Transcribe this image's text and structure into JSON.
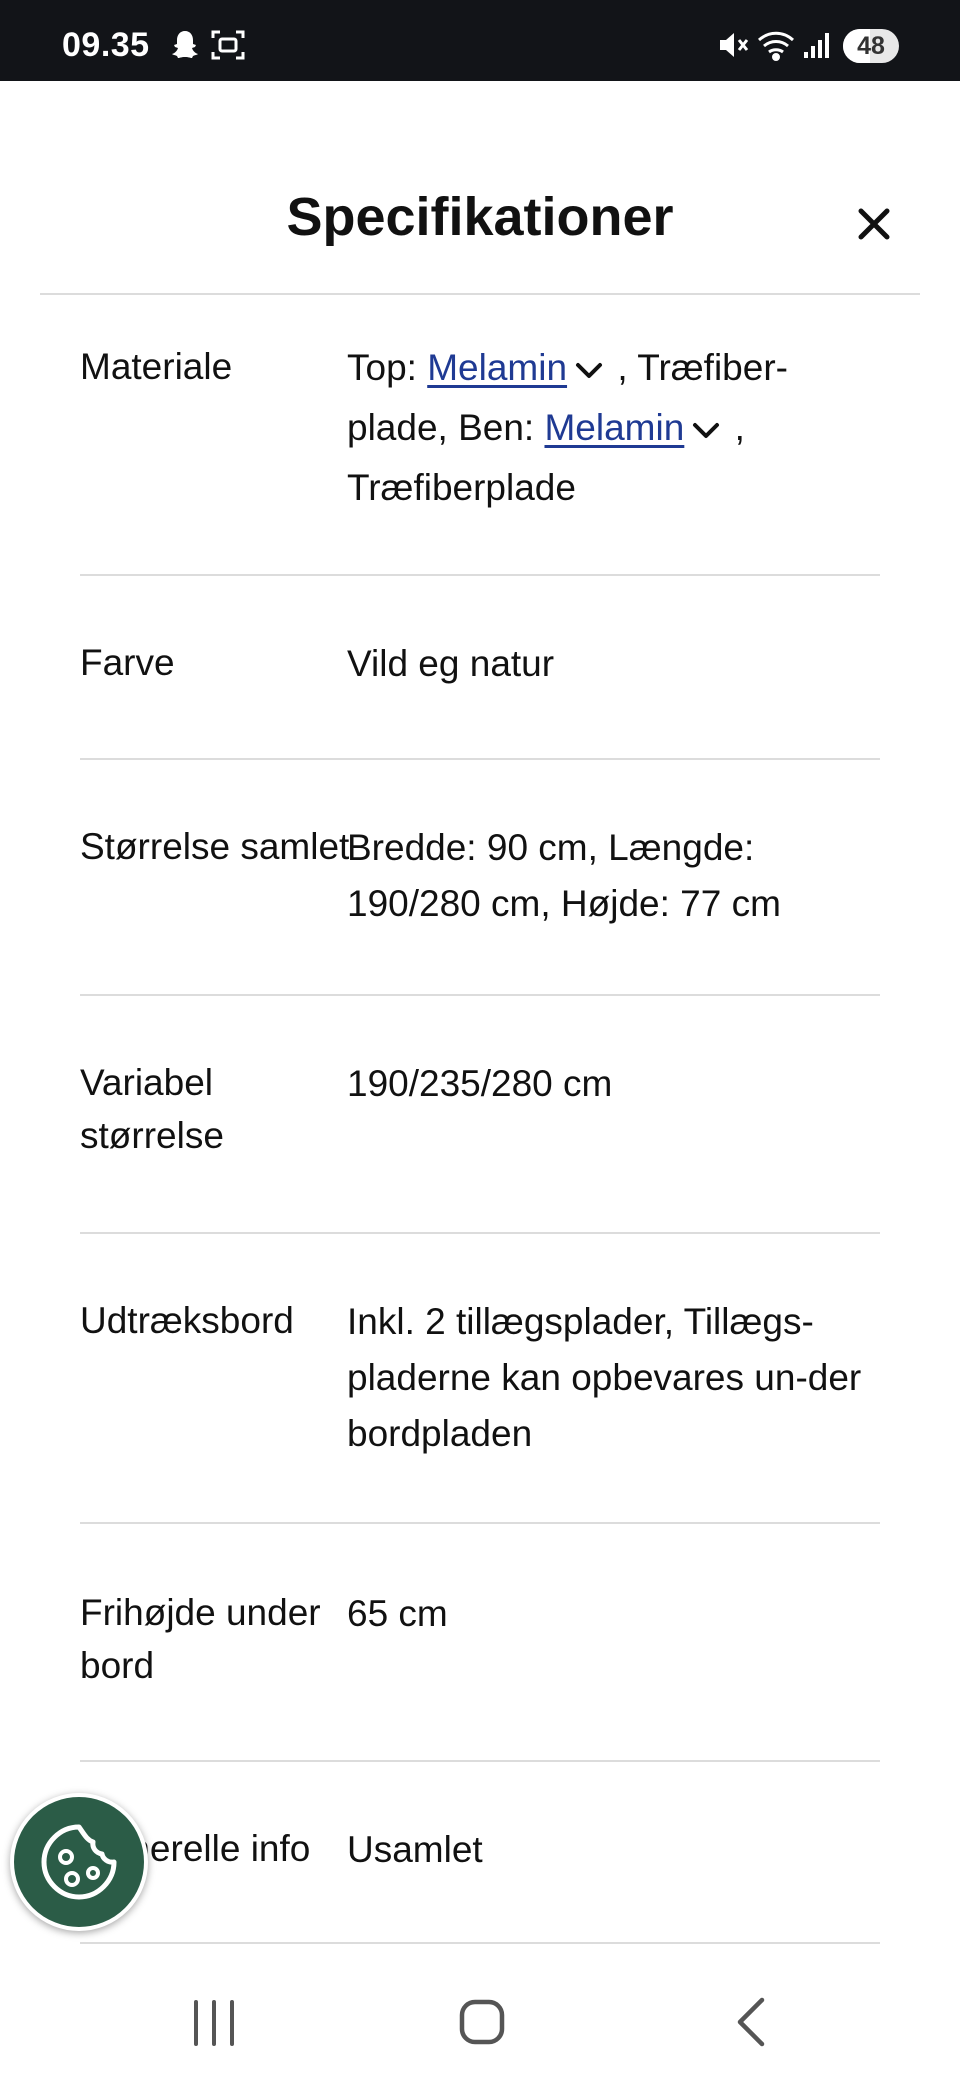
{
  "status_bar": {
    "time": "09.35",
    "battery": "48",
    "battery_level": 0.48,
    "icons": [
      "snapchat-icon",
      "screenshot-icon",
      "mute-icon",
      "wifi-icon",
      "signal-icon"
    ]
  },
  "sheet": {
    "title": "Specifikationer",
    "close_icon": "close-icon"
  },
  "specs": {
    "materiale": {
      "label": "Materiale",
      "top_prefix": "Top: ",
      "top_link": "Melamin",
      "top_suffix": " , Træfiber-plade, Ben: ",
      "ben_link": "Melamin",
      "ben_suffix": " , Træfiberplade"
    },
    "farve": {
      "label": "Farve",
      "value": "Vild eg natur"
    },
    "stoerrelse": {
      "label": "Størrelse samlet",
      "value": "Bredde: 90 cm, Længde: 190/280 cm, Højde: 77 cm"
    },
    "variabel": {
      "label": "Variabel størrelse",
      "value": "190/235/280 cm"
    },
    "udtraek": {
      "label": "Udtræksbord",
      "value": "Inkl. 2 tillægsplader, Tillægs-pladerne kan opbevares un-der bordpladen"
    },
    "frihoejde": {
      "label": "Frihøjde under bord",
      "value": "65 cm"
    },
    "generel": {
      "label": "Generelle info",
      "label_visible": "nle info",
      "value": "Usamlet"
    }
  },
  "cookie": {
    "icon": "cookie-icon"
  },
  "navbar": {
    "icons": [
      "recent-apps-icon",
      "home-icon",
      "back-icon"
    ]
  },
  "colors": {
    "status_bar_bg": "#121418",
    "link": "#1f3a93",
    "cookie_bg": "#2b5c47",
    "divider": "#dcdcdc"
  }
}
